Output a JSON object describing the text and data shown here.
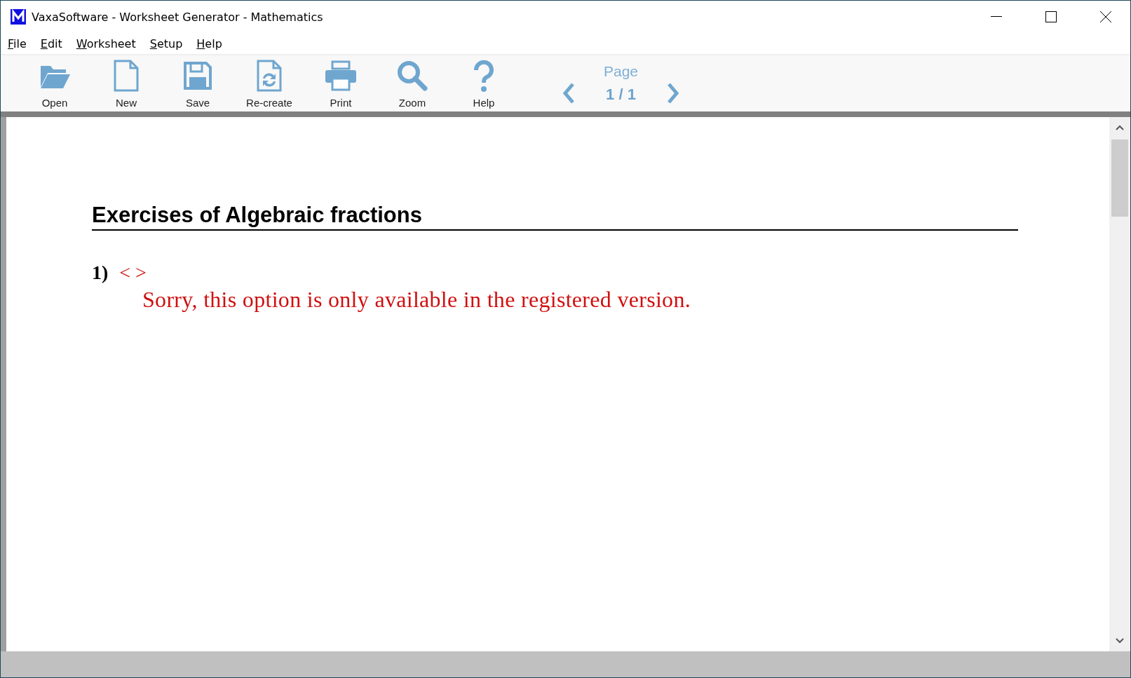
{
  "window": {
    "title": "VaxaSoftware - Worksheet Generator - Mathematics"
  },
  "menu": [
    "File",
    "Edit",
    "Worksheet",
    "Setup",
    "Help"
  ],
  "toolbar": [
    {
      "kind": "open",
      "label": "Open"
    },
    {
      "kind": "new",
      "label": "New"
    },
    {
      "kind": "save",
      "label": "Save"
    },
    {
      "kind": "recreate",
      "label": "Re-create"
    },
    {
      "kind": "print",
      "label": "Print"
    },
    {
      "kind": "zoom",
      "label": "Zoom"
    },
    {
      "kind": "help",
      "label": "Help"
    }
  ],
  "pager": {
    "label": "Page",
    "value": "1 / 1"
  },
  "document": {
    "title": "Exercises of Algebraic fractions",
    "exercises": [
      {
        "number": "1)",
        "content": "< >",
        "message": "Sorry, this option is only available in the registered version."
      }
    ]
  }
}
